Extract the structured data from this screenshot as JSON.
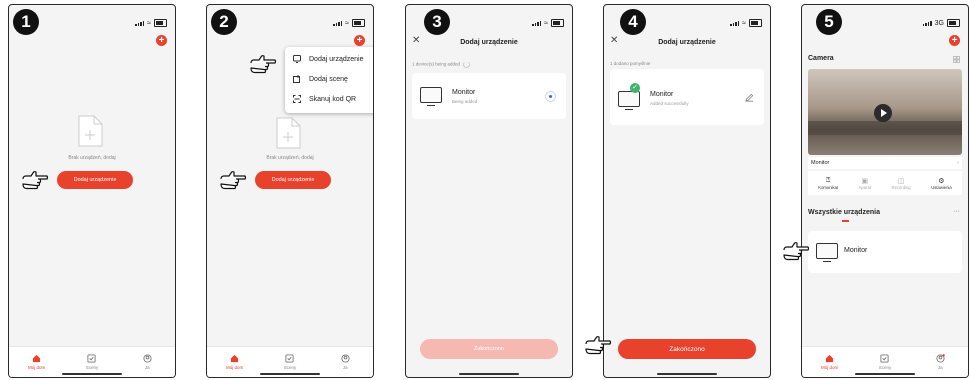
{
  "steps": [
    "1",
    "2",
    "3",
    "4",
    "5"
  ],
  "tabs": [
    {
      "label": "Mój dom",
      "active": true
    },
    {
      "label": "Sceny",
      "active": false
    },
    {
      "label": "Ja",
      "active": false
    }
  ],
  "home": {
    "empty_text": "Brak urządzeń, dodaj",
    "add_button": "Dodaj urządzenie"
  },
  "menu": {
    "items": [
      {
        "label": "Dodaj urządzenie",
        "icon": "device-icon"
      },
      {
        "label": "Dodaj scenę",
        "icon": "scene-icon"
      },
      {
        "label": "Skanuj kod QR",
        "icon": "qr-scan-icon"
      }
    ]
  },
  "adding": {
    "title": "Dodaj urządzenie",
    "subtitle": "1 device(s) being added",
    "device_name": "Monitor",
    "device_status": "Being added",
    "done_button": "Zakończono"
  },
  "added": {
    "title": "Dodaj urządzenie",
    "subtitle": "1 dodano pomyślnie",
    "device_name": "Monitor",
    "device_status": "Added successfully",
    "done_button": "Zakończono"
  },
  "home_device": {
    "status_network": "3G",
    "camera_title": "Camera",
    "camera_device": "Monitor",
    "actions": [
      "Komunikat",
      "Aparat",
      "Recording",
      "Ustawienia"
    ],
    "all_devices_title": "Wszystkie urządzenia",
    "more": "···",
    "device_name": "Monitor"
  },
  "colors": {
    "accent": "#e8412c",
    "success": "#3db36b"
  }
}
